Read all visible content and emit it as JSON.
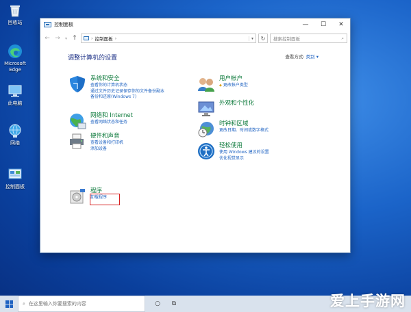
{
  "desktop": {
    "icons": [
      {
        "name": "recycle-bin",
        "label": "回收站"
      },
      {
        "name": "edge",
        "label": "Microsoft Edge"
      },
      {
        "name": "this-pc",
        "label": "此电脑"
      },
      {
        "name": "network",
        "label": "网络"
      },
      {
        "name": "control-panel",
        "label": "控制面板"
      }
    ]
  },
  "window": {
    "title": "控制面板",
    "minimize": "—",
    "maximize": "☐",
    "close": "✕",
    "address": {
      "path": "控制面板",
      "separator": "›"
    },
    "search_placeholder": "搜索控制面板",
    "heading": "调整计算机的设置",
    "view_by_label": "查看方式:",
    "view_by_value": "类别 ▾",
    "categories": [
      {
        "title": "系统和安全",
        "links": [
          "查看你的计算机状态",
          "通过文件历史记录保存你的文件备份副本",
          "备份和还原(Windows 7)"
        ]
      },
      {
        "title": "网络和 Internet",
        "links": [
          "查看网络状态和任务"
        ]
      },
      {
        "title": "硬件和声音",
        "links": [
          "查看设备和打印机",
          "添加设备"
        ]
      },
      {
        "title": "程序",
        "links": [
          "卸载程序"
        ]
      },
      {
        "title": "用户帐户",
        "links": [
          "更改帐户类型"
        ]
      },
      {
        "title": "外观和个性化",
        "links": []
      },
      {
        "title": "时钟和区域",
        "links": [
          "更改日期、时间或数字格式"
        ]
      },
      {
        "title": "轻松使用",
        "links": [
          "使用 Windows 建议的设置",
          "优化视觉显示"
        ]
      }
    ]
  },
  "taskbar": {
    "search_placeholder": "在这里输入你要搜索的内容"
  },
  "watermark": "爱上手游网"
}
